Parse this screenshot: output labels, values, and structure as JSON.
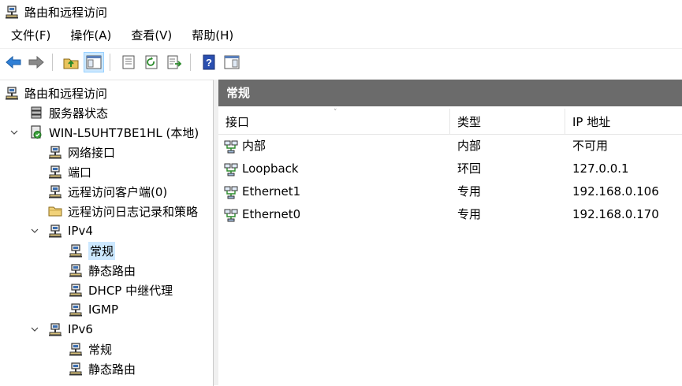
{
  "window": {
    "title": "路由和远程访问"
  },
  "menu": [
    "文件(F)",
    "操作(A)",
    "查看(V)",
    "帮助(H)"
  ],
  "toolbar": {
    "buttons": [
      "back-icon",
      "forward-icon",
      "up-folder-icon",
      "show-hide-tree-icon",
      "properties-icon",
      "refresh-icon",
      "export-list-icon",
      "help-icon",
      "action-pane-icon"
    ]
  },
  "tree": {
    "root": "路由和远程访问",
    "server_status": "服务器状态",
    "server": "WIN-L5UHT7BE1HL (本地)",
    "network_interfaces": "网络接口",
    "ports": "端口",
    "remote_clients": "远程访问客户端(0)",
    "logging": "远程访问日志记录和策略",
    "ipv4": "IPv4",
    "ipv4_general": "常规",
    "ipv4_static": "静态路由",
    "dhcp_relay": "DHCP 中继代理",
    "igmp": "IGMP",
    "ipv6": "IPv6",
    "ipv6_general": "常规",
    "ipv6_static": "静态路由"
  },
  "details": {
    "header": "常规",
    "columns": [
      "接口",
      "类型",
      "IP 地址"
    ],
    "rows": [
      {
        "name": "内部",
        "type": "内部",
        "ip": "不可用"
      },
      {
        "name": "Loopback",
        "type": "环回",
        "ip": "127.0.0.1"
      },
      {
        "name": "Ethernet1",
        "type": "专用",
        "ip": "192.168.0.106"
      },
      {
        "name": "Ethernet0",
        "type": "专用",
        "ip": "192.168.0.170"
      }
    ]
  },
  "colors": {
    "header_bg": "#6b6b6b",
    "selection": "#cce8ff",
    "accent_blue": "#2a6fc9"
  }
}
